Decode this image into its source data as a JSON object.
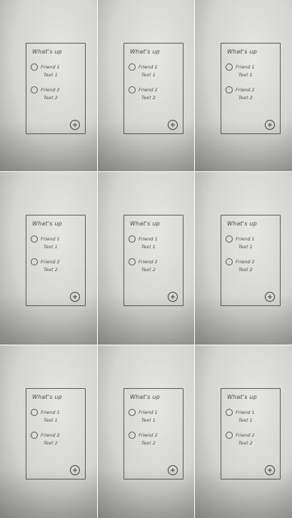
{
  "sketch": {
    "title": "What's up",
    "items": [
      {
        "name": "Friend 1",
        "text": "Text 1"
      },
      {
        "name": "Friend 2",
        "text": "Text 2"
      }
    ],
    "fab_icon": "plus-icon"
  }
}
